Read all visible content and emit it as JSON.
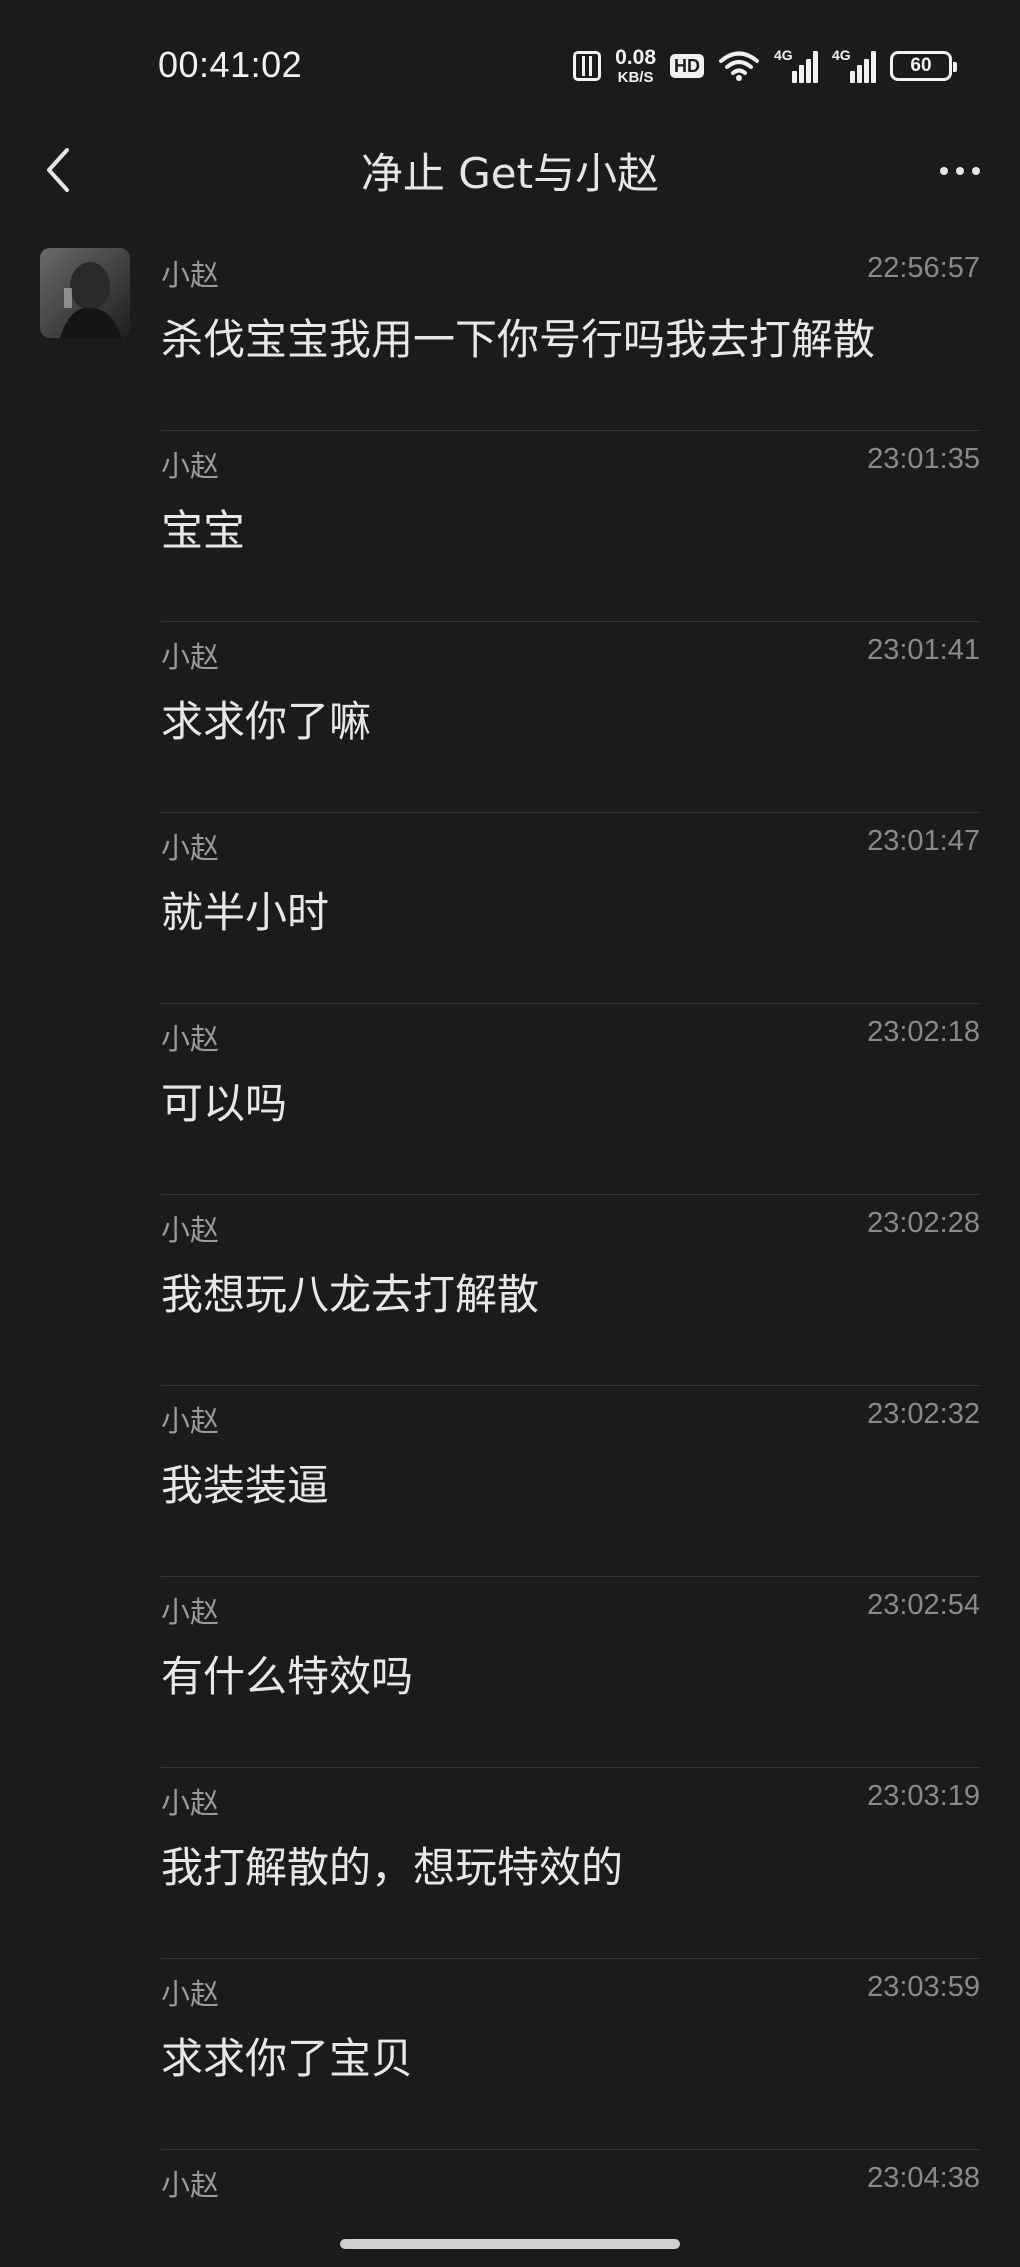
{
  "status_bar": {
    "time": "00:41:02",
    "net_speed_value": "0.08",
    "net_speed_unit": "KB/S",
    "hd_label": "HD",
    "signal1_label": "4G",
    "signal2_label": "4G",
    "battery": "60"
  },
  "header": {
    "title": "净止 Get与小赵"
  },
  "messages": [
    {
      "sender": "小赵",
      "time": "22:56:57",
      "text": "杀伐宝宝我用一下你号行吗我去打解散"
    },
    {
      "sender": "小赵",
      "time": "23:01:35",
      "text": "宝宝"
    },
    {
      "sender": "小赵",
      "time": "23:01:41",
      "text": "求求你了嘛"
    },
    {
      "sender": "小赵",
      "time": "23:01:47",
      "text": "就半小时"
    },
    {
      "sender": "小赵",
      "time": "23:02:18",
      "text": "可以吗"
    },
    {
      "sender": "小赵",
      "time": "23:02:28",
      "text": "我想玩八龙去打解散"
    },
    {
      "sender": "小赵",
      "time": "23:02:32",
      "text": "我装装逼"
    },
    {
      "sender": "小赵",
      "time": "23:02:54",
      "text": "有什么特效吗"
    },
    {
      "sender": "小赵",
      "time": "23:03:19",
      "text": "我打解散的，想玩特效的"
    },
    {
      "sender": "小赵",
      "time": "23:03:59",
      "text": "求求你了宝贝"
    },
    {
      "sender": "小赵",
      "time": "23:04:38",
      "text": ""
    }
  ],
  "colors": {
    "background": "#1b1b1b",
    "text": "#e8e8e8",
    "meta": "#8a8a8a",
    "divider": "#343434"
  }
}
